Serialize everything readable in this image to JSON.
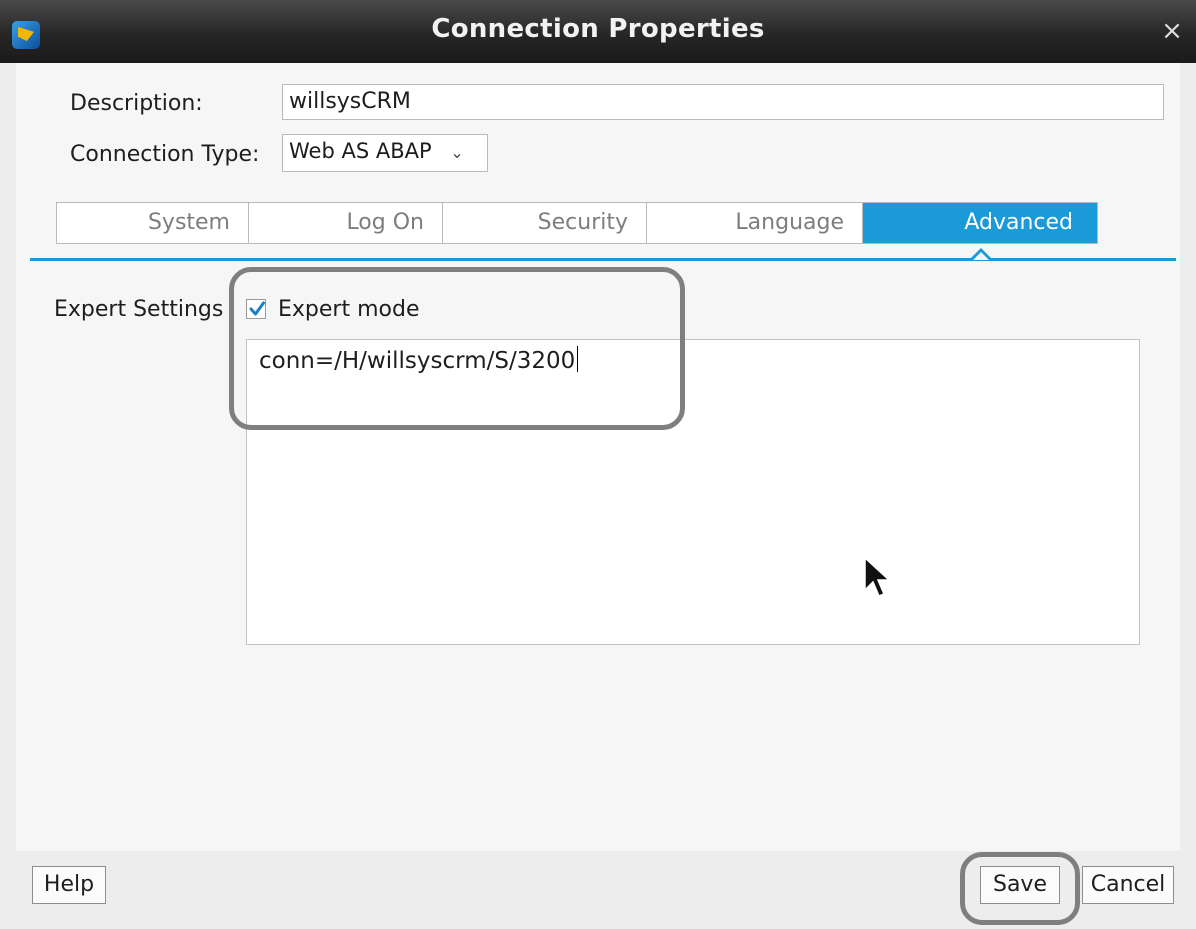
{
  "window": {
    "title": "Connection Properties",
    "close_glyph": "×",
    "app_icon": "app-logo-icon"
  },
  "form": {
    "description_label": "Description:",
    "description_value": "willsysCRM",
    "connection_type_label": "Connection Type:",
    "connection_type_value": "Web AS ABAP"
  },
  "tabs": [
    {
      "label": "System",
      "active": false
    },
    {
      "label": "Log On",
      "active": false
    },
    {
      "label": "Security",
      "active": false
    },
    {
      "label": "Language",
      "active": false
    },
    {
      "label": "Advanced",
      "active": true
    }
  ],
  "advanced": {
    "expert_settings_label": "Expert Settings",
    "expert_mode_label": "Expert mode",
    "expert_mode_checked": true,
    "connection_string": "conn=/H/willsyscrm/S/3200"
  },
  "buttons": {
    "help": "Help",
    "save": "Save",
    "cancel": "Cancel"
  },
  "colors": {
    "accent": "#1a9ad6",
    "titlebar": "#262626",
    "highlight": "#7f7f7f"
  }
}
